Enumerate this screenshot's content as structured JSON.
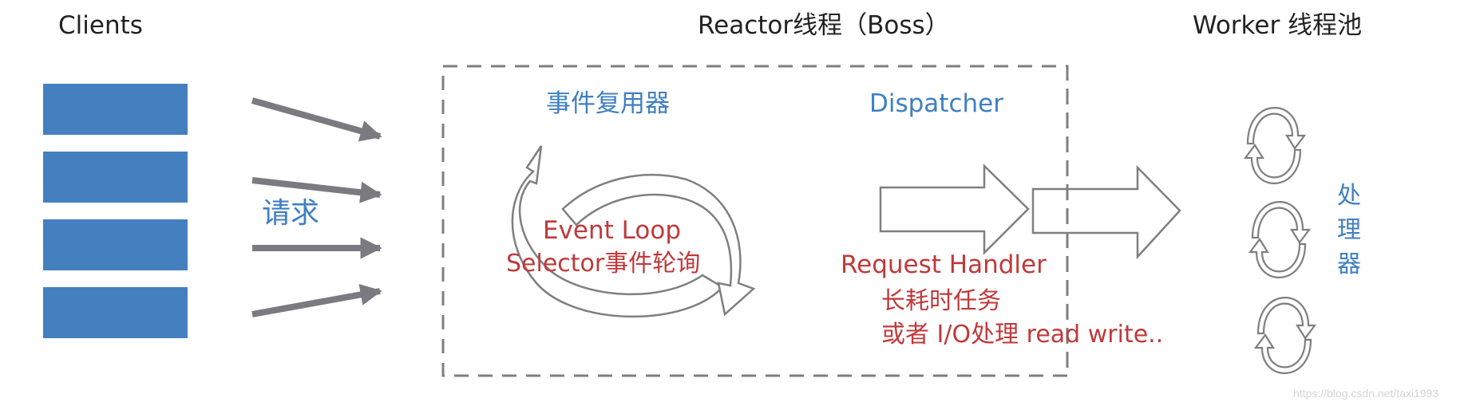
{
  "titles": {
    "clients": "Clients",
    "reactor": "Reactor线程（Boss）",
    "worker": "Worker 线程池"
  },
  "clients": {
    "count": 4,
    "request_label": "请求"
  },
  "reactor": {
    "multiplexer_label": "事件复用器",
    "dispatcher_label": "Dispatcher",
    "event_loop_line1": "Event Loop",
    "event_loop_line2": "Selector事件轮询",
    "handler_line1": "Request Handler",
    "handler_line2": "长耗时任务",
    "handler_line3": "或者 I/O处理 read write.."
  },
  "worker": {
    "processor_chars": [
      "处",
      "理",
      "器"
    ],
    "processor_count": 3
  },
  "watermark": "https://blog.csdn.net/taxi1993",
  "colors": {
    "client_box": "#4480c0",
    "label_blue": "#3f7fc1",
    "label_red": "#c0393b",
    "arrow_gray": "#7a7a80",
    "outline_gray": "#7f7f7f"
  }
}
